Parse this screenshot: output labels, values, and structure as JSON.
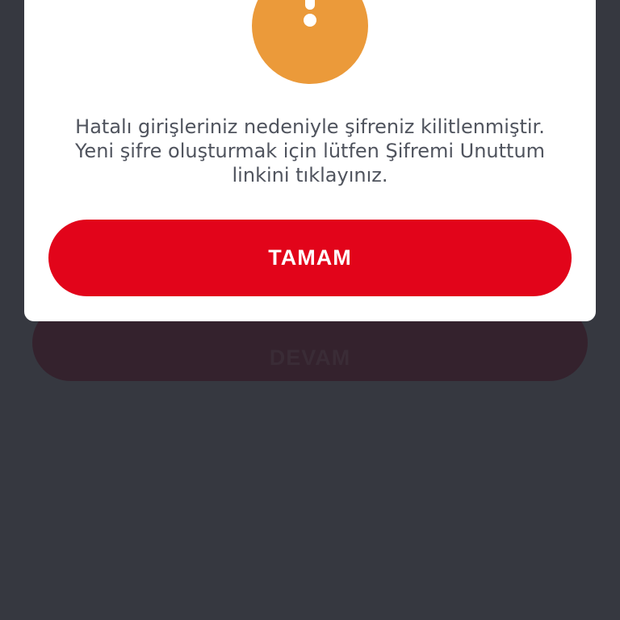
{
  "background_button": {
    "label": "DEVAM"
  },
  "dialog": {
    "message_lines": [
      "Hatalı girişleriniz nedeniyle şifreniz kilitlenmiştir.",
      "Yeni şifre oluşturmak için lütfen Şifremi Unuttum",
      "linkini tıklayınız."
    ],
    "confirm_label": "TAMAM",
    "icon": "exclamation-icon"
  },
  "colors": {
    "overlay": "#363840",
    "dialog_background": "#ffffff",
    "alert_icon": "#eb9a3a",
    "confirm_button": "#e2041a",
    "message_text": "#50545e",
    "dimmed_button": "#34222d"
  }
}
